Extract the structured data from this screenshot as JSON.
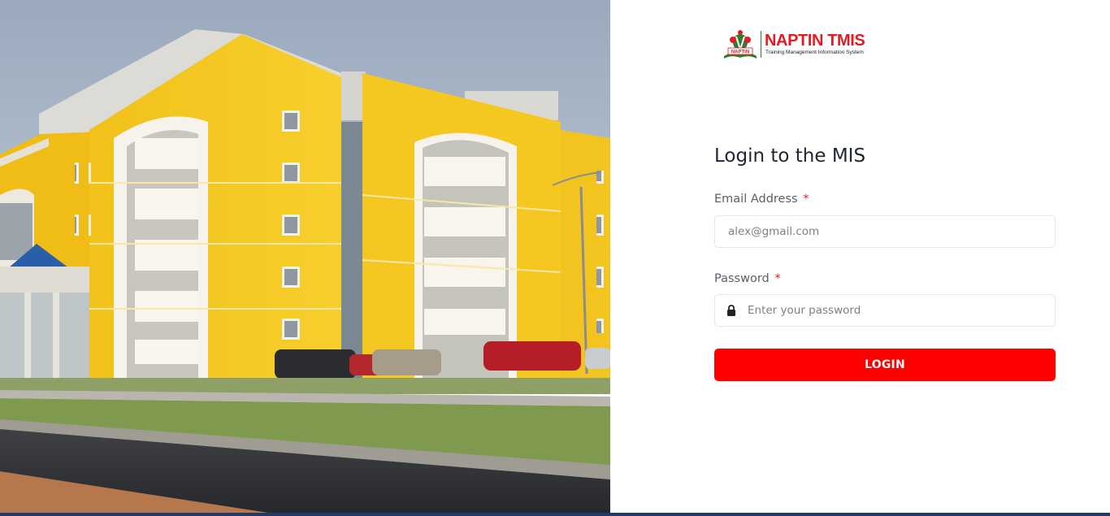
{
  "brand": {
    "name": "NAPTIN TMIS",
    "tagline": "Training Management Information System",
    "emblem_text": "NAPTIN"
  },
  "login": {
    "title": "Login to the MIS",
    "email": {
      "label": "Email Address",
      "required_mark": "*",
      "placeholder": "alex@gmail.com",
      "value": ""
    },
    "password": {
      "label": "Password",
      "required_mark": "*",
      "placeholder": "Enter your password",
      "value": "",
      "icon": "lock-icon"
    },
    "submit_label": "LOGIN"
  },
  "colors": {
    "accent_red": "#fe0000",
    "brand_red": "#e31b23",
    "brand_green": "#2e7d32",
    "bottom_bar": "#1f3b67"
  }
}
